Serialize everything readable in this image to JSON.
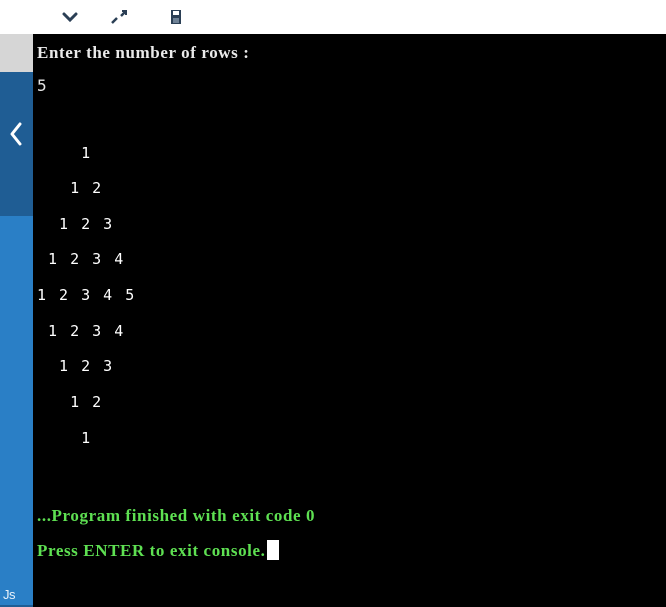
{
  "toolbar": {
    "icons": [
      "chevron-down-icon",
      "expand-icon",
      "save-icon"
    ]
  },
  "sidebar": {
    "collapse_icon": "chevron-left-icon",
    "label": "Js"
  },
  "console": {
    "prompt": "Enter the number of rows :",
    "input": "5",
    "pattern_rows": [
      "    1",
      "   1 2",
      "  1 2 3",
      " 1 2 3 4",
      "1 2 3 4 5",
      " 1 2 3 4",
      "  1 2 3",
      "   1 2",
      "    1"
    ],
    "finished_message": "...Program finished with exit code 0",
    "exit_message": "Press ENTER to exit console."
  },
  "colors": {
    "background": "#000000",
    "text": "#e6e6e6",
    "success": "#5ee052",
    "sidebar": "#2a7fc6"
  }
}
